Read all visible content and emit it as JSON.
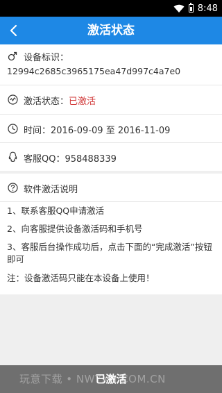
{
  "status_bar": {
    "time": "8:48",
    "icons": [
      "wifi-icon",
      "battery-icon"
    ]
  },
  "app_bar": {
    "title": "激活状态",
    "back_icon": "chevron-left-icon"
  },
  "info": {
    "device_id_label": "设备标识：",
    "device_id_value": "12994c2685c3965175ea47d997c4a7e0",
    "status_label": "激活状态：",
    "status_value": "已激活",
    "time_label": "时间：",
    "time_value": "2016-09-09 至 2016-11-09",
    "support_label": "客服QQ：",
    "support_value": "958488339"
  },
  "instructions": {
    "title": "软件激活说明",
    "step1": "1、联系客服QQ申请激活",
    "step2": "2、向客服提供设备激活码和手机号",
    "step3_line1": "3、客服后台操作成功后，点击下面的“完成激活”按钮",
    "step3_line2": "即可",
    "note": "注：设备激活码只能在本设备上使用！"
  },
  "bottom": {
    "button_label": "已激活",
    "watermark": "玩意下载 • NWYXH.COM.CN"
  },
  "colors": {
    "accent": "#1e88e5",
    "status_red": "#d23b3b",
    "bottom_bar": "#6f6f6f"
  }
}
